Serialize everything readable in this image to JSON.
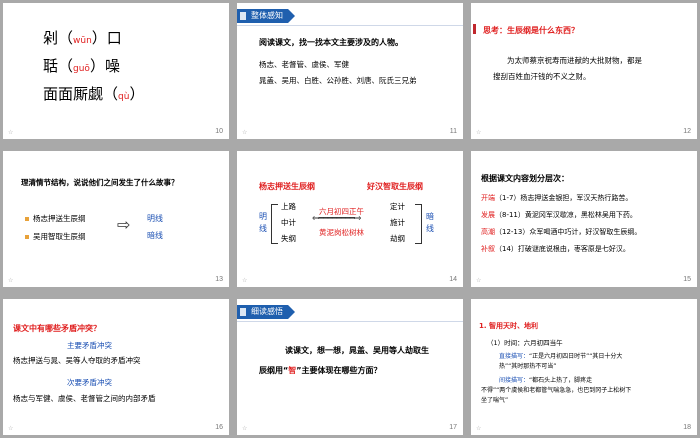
{
  "slides": {
    "s10": {
      "num": "10",
      "line1_a": "剁（",
      "line1_py": "wūn",
      "line1_b": "）口",
      "line2_a": "聒（",
      "line2_py": "guō",
      "line2_b": "）噪",
      "line3_a": "面面厮觑（",
      "line3_py": "qù",
      "line3_b": "）"
    },
    "s11": {
      "num": "11",
      "banner": "整体感知",
      "title": "阅读课文，找一找本文主要涉及的人物。",
      "line1": "杨志、老督管、虞侯、军健",
      "line2": "晁盖、吴用、白胜、公孙胜、刘唐、阮氏三兄弟"
    },
    "s12": {
      "num": "12",
      "question": "思考：生辰纲是什么东西？",
      "answer1": "为太师蔡京祝寿而进献的大批财物，都是",
      "answer2": "搜刮百姓血汗钱的不义之财。"
    },
    "s13": {
      "num": "13",
      "title": "理清情节结构，说说他们之间发生了什么故事？",
      "item1": "杨志押送生辰纲",
      "item2": "吴用智取生辰纲",
      "arrow": "⇨",
      "right1": "明线",
      "right2": "暗线"
    },
    "s14": {
      "num": "14",
      "head_left": "杨志押送生辰纲",
      "head_right": "好汉智取生辰纲",
      "left_v": "明线",
      "left_items": [
        "上路",
        "中计",
        "失纲"
      ],
      "center_top": "六月初四正午",
      "center_bottom": "黄泥岗松树林",
      "right_items": [
        "定计",
        "施计",
        "劫纲"
      ],
      "right_v": "暗线"
    },
    "s15": {
      "num": "15",
      "title": "根据课文内容划分层次：",
      "rows": [
        {
          "label": "开端",
          "text": "（1-7）杨志押送金银担，军汉天热行路苦。"
        },
        {
          "label": "发展",
          "text": "（8-11）黄泥冈军汉歇凉，黑松林吴用下药。"
        },
        {
          "label": "高潮",
          "text": "（12-13）众军喝酒中巧计，好汉智取生辰纲。"
        },
        {
          "label": "补叙",
          "text": "（14）打破谜底说根由，枣客原是七好汉。"
        }
      ]
    },
    "s16": {
      "num": "16",
      "title": "课文中有哪些矛盾冲突？",
      "sub1": "主要矛盾冲突",
      "text1": "杨志押送与晁、吴等人夺取的矛盾冲突",
      "sub2": "次要矛盾冲突",
      "text2": "杨志与军健、虞侯、老督管之间的内部矛盾"
    },
    "s17": {
      "num": "17",
      "banner": "细读感悟",
      "line1": "读课文，想一想，晁盖、吴用等人劫取生",
      "line2_a": "辰纲用“",
      "line2_red": "智",
      "line2_b": "”主要体现在哪些方面？"
    },
    "s18": {
      "num": "18",
      "head": "1. 智用天时、地利",
      "time": "（1）时间：六月初四当午",
      "d1_label": "直接描写：",
      "d1_text": "“正是六月初四日时节”“其日十分大",
      "d1_text2": "热”“其时那热不可当”",
      "d2_label": "间接描写：",
      "d2_text": "“都石头上热了，脚疼走",
      "d2_text2": "不得”“两个虞侯和老都管气喘急急，也巴到冈子上松树下",
      "d2_text3": "坐了喘气”"
    }
  }
}
